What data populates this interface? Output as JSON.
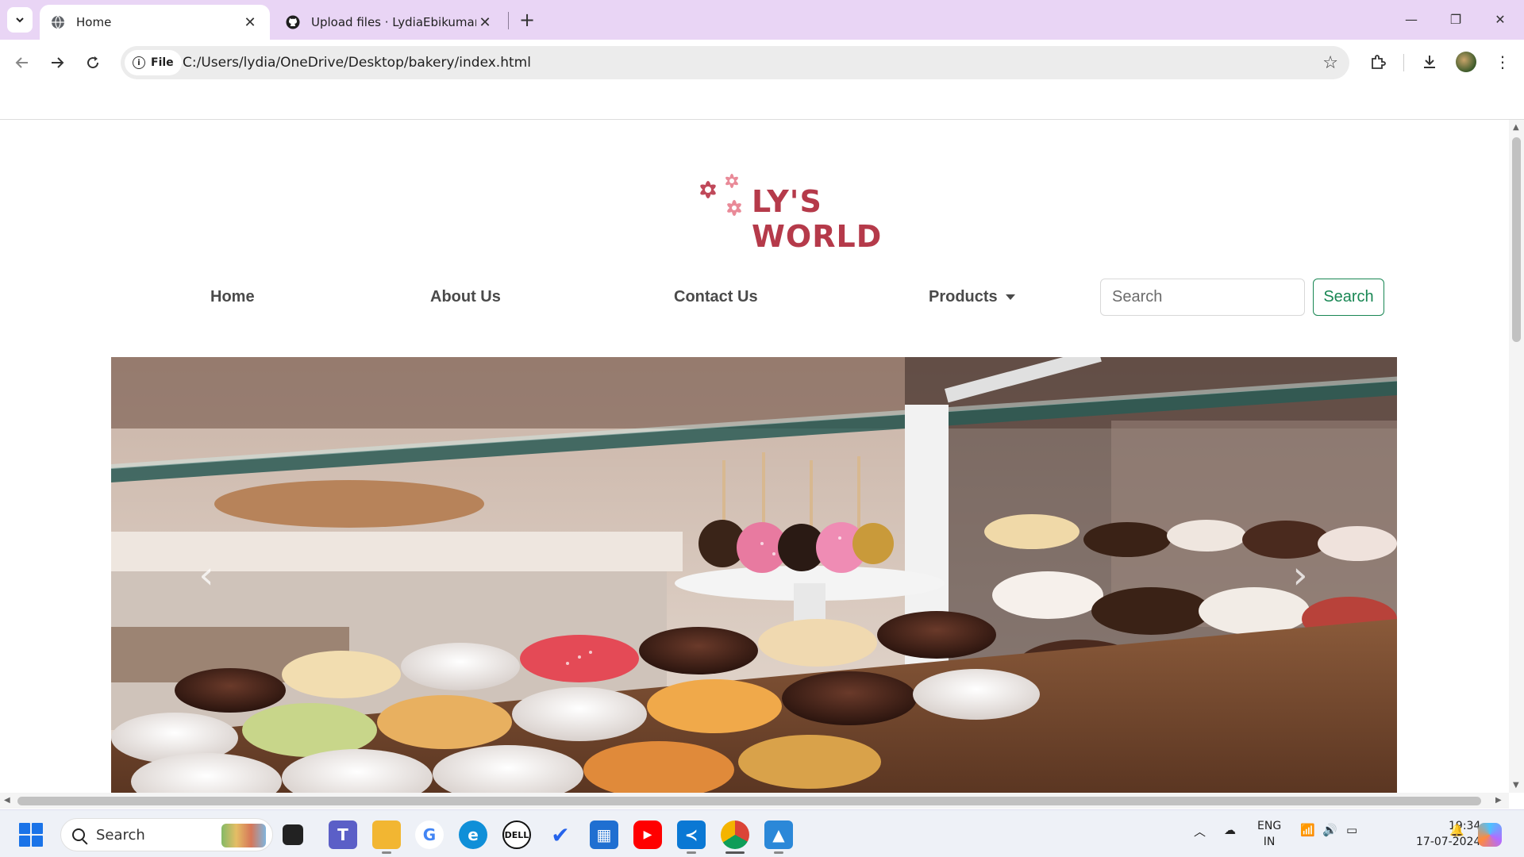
{
  "browser": {
    "tabs": [
      {
        "title": "Home",
        "icon": "globe-icon",
        "active": true
      },
      {
        "title": "Upload files · LydiaEbikumar/Sta",
        "icon": "github-icon",
        "active": false
      }
    ],
    "address": {
      "scheme_label": "File",
      "url": "C:/Users/lydia/OneDrive/Desktop/bakery/index.html"
    }
  },
  "site": {
    "logo_text": "LY'S WORLD",
    "nav": [
      {
        "label": "Home"
      },
      {
        "label": "About Us"
      },
      {
        "label": "Contact Us"
      },
      {
        "label": "Products"
      }
    ],
    "search": {
      "placeholder": "Search",
      "button_label": "Search"
    },
    "carousel": {
      "image": "bakery display case with donuts, cake pops and pastries",
      "prev_icon": "chevron-left-icon",
      "next_icon": "chevron-right-icon"
    }
  },
  "taskbar": {
    "search_placeholder": "Search",
    "apps": [
      "file-explorer-icon",
      "teams-icon",
      "folder-icon",
      "google-icon",
      "edge-icon",
      "dell-icon",
      "todo-icon",
      "store-icon",
      "youtube-icon",
      "vscode-icon",
      "chrome-icon",
      "photos-icon"
    ],
    "language": {
      "line1": "ENG",
      "line2": "IN"
    },
    "time": "19:34",
    "date": "17-07-2024"
  },
  "colors": {
    "tabstrip": "#e9d5f5",
    "logo": "#b53a4a",
    "search_button": "#198754"
  }
}
